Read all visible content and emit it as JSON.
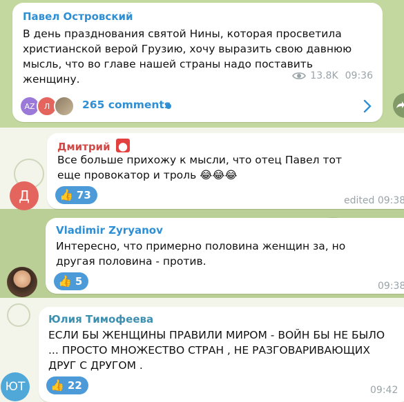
{
  "post": {
    "author": "Павел Островский",
    "text": "В день празднования святой Нины, которая просветила христианской верой Грузию, хочу выразить свою давнюю мысль, что во главе нашей страны надо поставить женщину.",
    "views": "13.8K",
    "time": "09:36",
    "comment_avatars": [
      "AZ",
      "Л",
      ""
    ],
    "comments_label": "265 comments"
  },
  "comments": [
    {
      "author": "Дмитрий",
      "author_color": "#d04a47",
      "avatar": "Д",
      "avatar_color": "#e3655d",
      "text": "Все больше прихожу к мысли, что отец Павел тот еще провокатор и троль 😂😂😂",
      "reaction": "73",
      "time": "edited 09:38"
    },
    {
      "author": "Vladimir Zyryanov",
      "author_color": "#2e8fd4",
      "avatar": "",
      "avatar_color": "#8a6a4e",
      "text": "Интересно, что примерно половина женщин за, но другая половина - против.",
      "reaction": "5",
      "time": "09:38"
    },
    {
      "author": "Юлия Тимофеева",
      "author_color": "#3d8fb0",
      "avatar": "ЮТ",
      "avatar_color": "#4fa8d8",
      "text": "ЕСЛИ БЫ ЖЕНЩИНЫ ПРАВИЛИ МИРОМ - ВОЙН БЫ НЕ БЫЛО ... ПРОСТО МНОЖЕСТВО СТРАН , НЕ РАЗГОВАРИВАЮЩИХ ДРУГ С ДРУГОМ .",
      "reaction": "22",
      "time": "09:42"
    }
  ],
  "icons": {
    "eye": "eye-icon",
    "thumb": "👍",
    "chevron": "›",
    "forward": "forward-icon"
  },
  "colors": {
    "accent": "#2e8fd4",
    "reaction": "#4c9bd8"
  }
}
